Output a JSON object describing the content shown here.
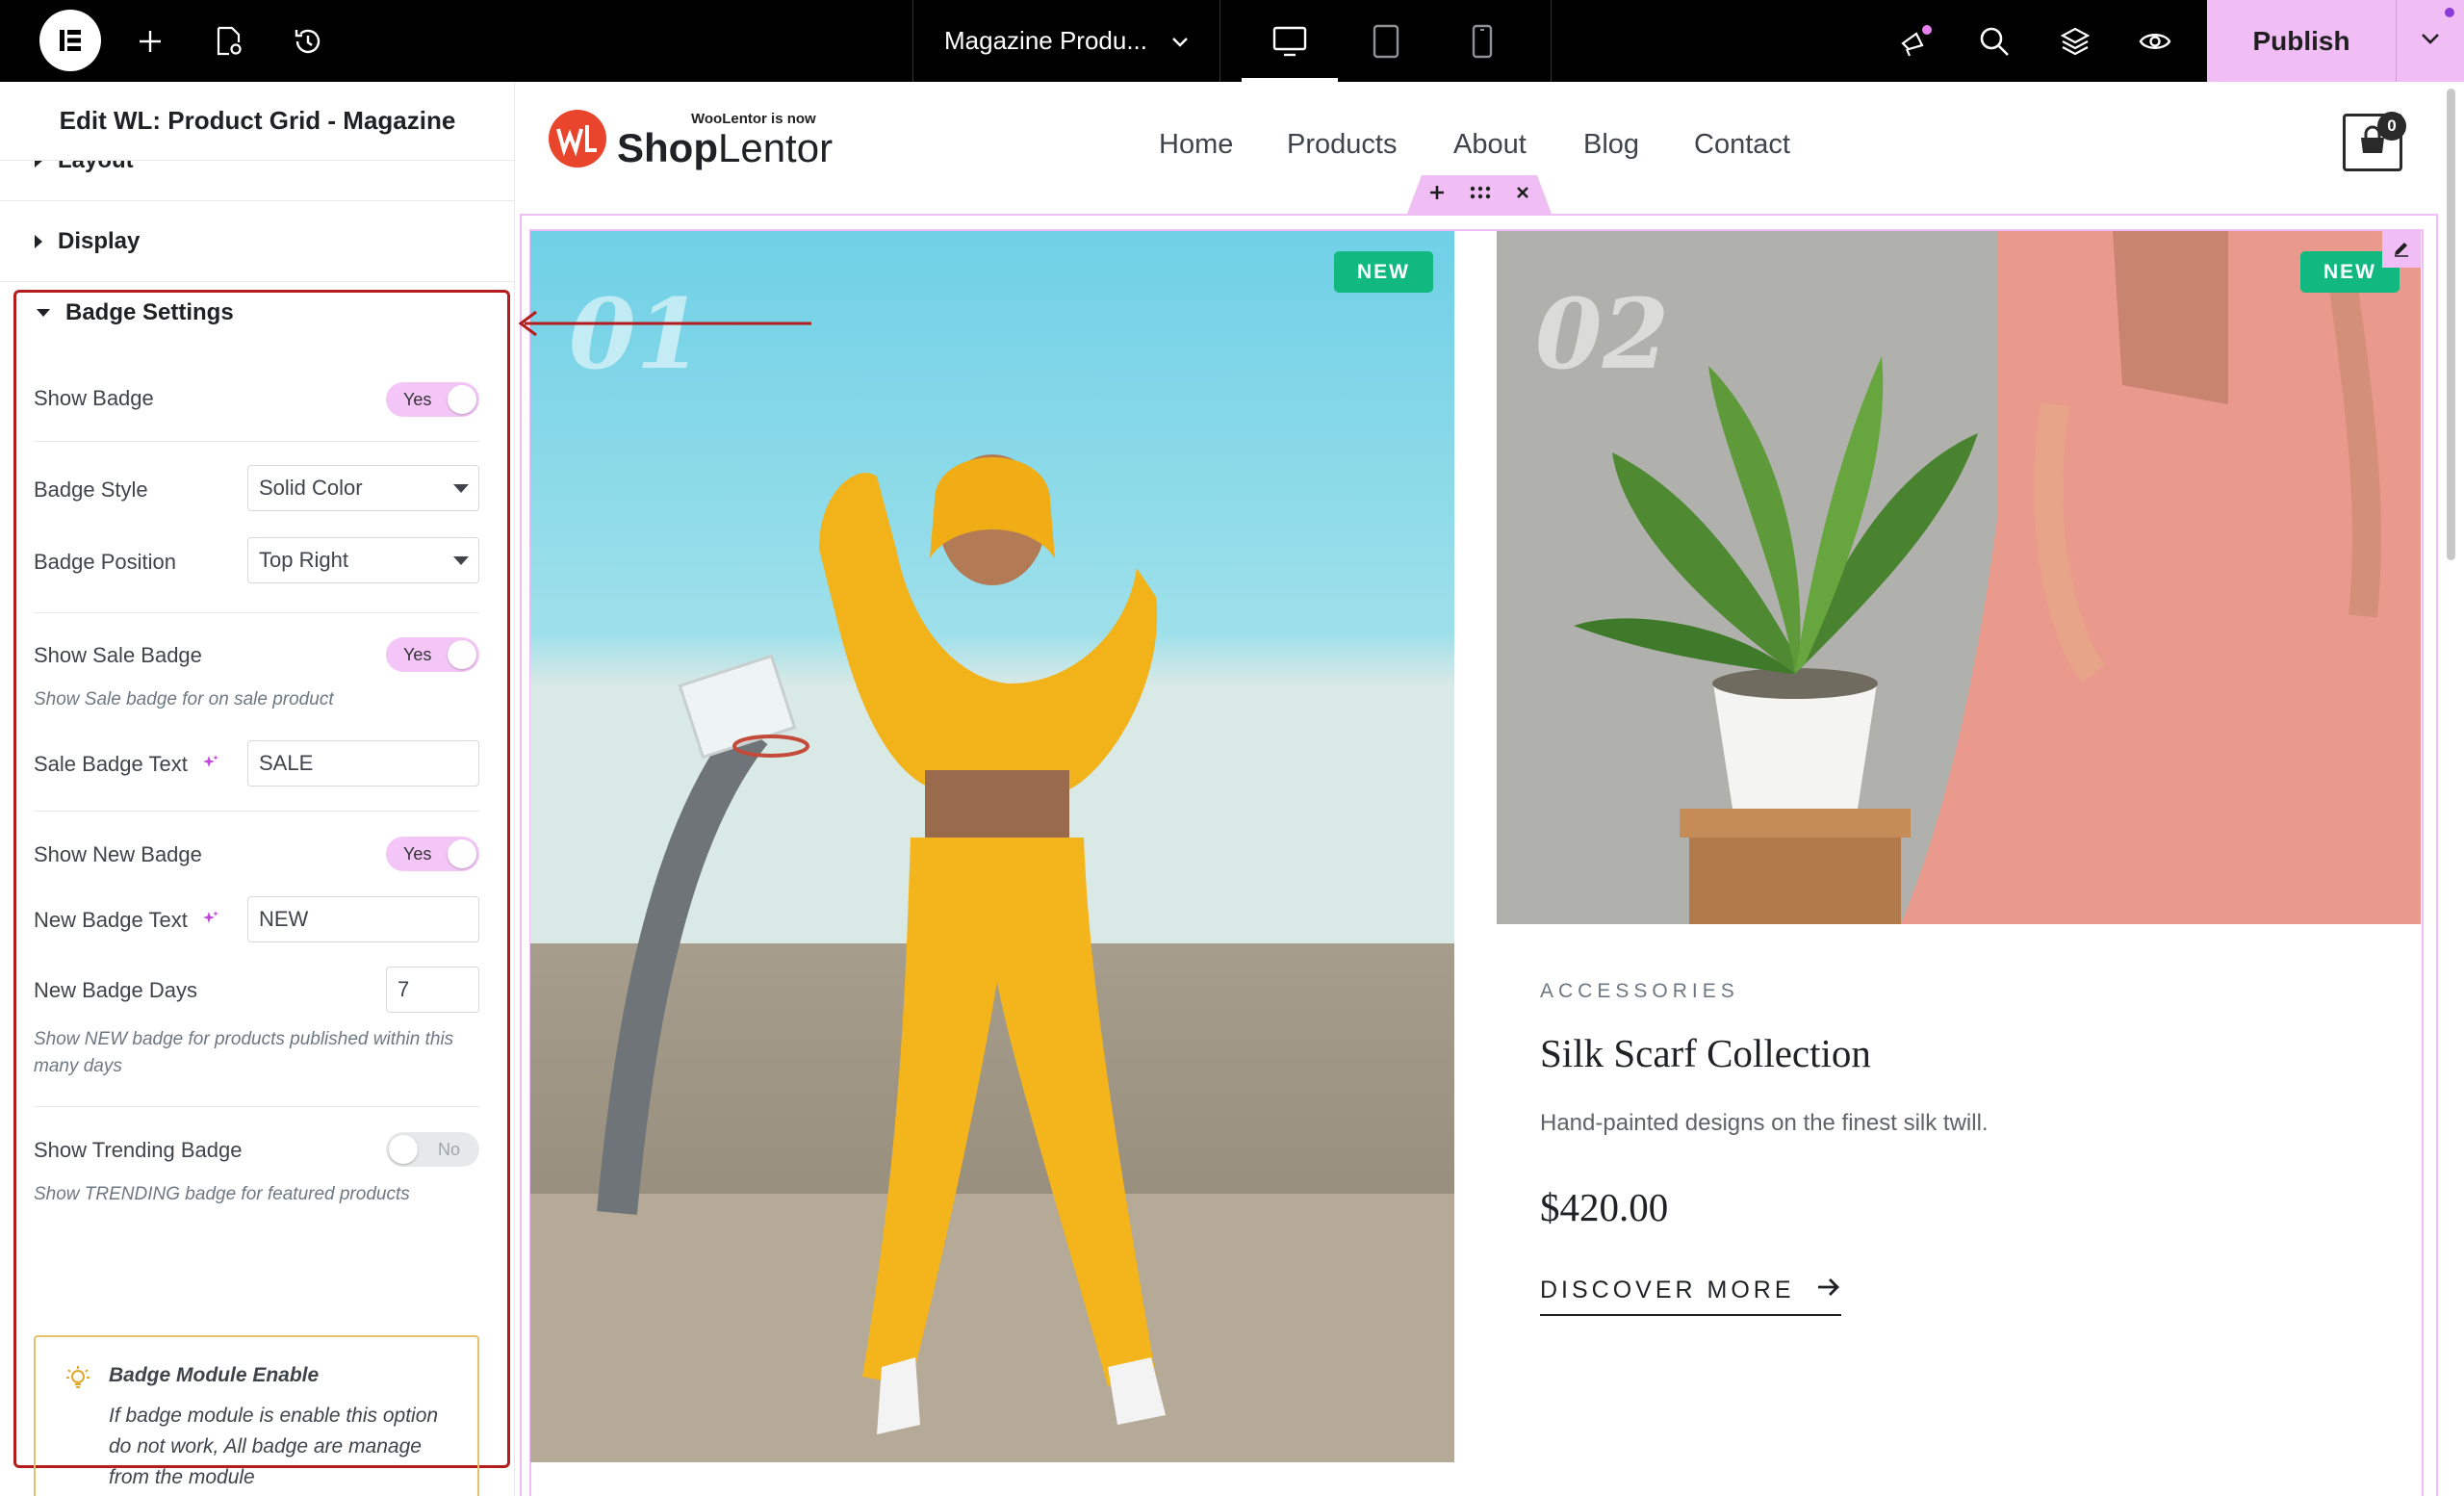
{
  "topbar": {
    "document_title": "Magazine Produ...",
    "publish_label": "Publish",
    "icons": [
      "elementor-logo-icon",
      "plus-icon",
      "page-settings-icon",
      "history-icon",
      "desktop-icon",
      "tablet-icon",
      "mobile-icon",
      "whats-new-icon",
      "search-icon",
      "layers-icon",
      "preview-eye-icon",
      "chevron-down-icon"
    ]
  },
  "panel": {
    "title": "Edit WL: Product Grid - Magazine",
    "sections": {
      "layout": "Layout",
      "display": "Display",
      "badge_settings": "Badge Settings"
    },
    "controls": {
      "show_badge": {
        "label": "Show Badge",
        "value": "Yes"
      },
      "badge_style": {
        "label": "Badge Style",
        "value": "Solid Color"
      },
      "badge_position": {
        "label": "Badge Position",
        "value": "Top Right"
      },
      "show_sale_badge": {
        "label": "Show Sale Badge",
        "value": "Yes",
        "note": "Show Sale badge for on sale product"
      },
      "sale_badge_text": {
        "label": "Sale Badge Text",
        "value": "SALE"
      },
      "show_new_badge": {
        "label": "Show New Badge",
        "value": "Yes"
      },
      "new_badge_text": {
        "label": "New Badge Text",
        "value": "NEW"
      },
      "new_badge_days": {
        "label": "New Badge Days",
        "value": "7",
        "note": "Show NEW badge for products published within this many days"
      },
      "show_trending_badge": {
        "label": "Show Trending Badge",
        "value": "No",
        "note": "Show TRENDING badge for featured products"
      }
    },
    "notice": {
      "title": "Badge Module Enable",
      "body": "If badge module is enable this option do not work, All badge are manage from the module"
    }
  },
  "site": {
    "logo_tagline": "WooLentor is now",
    "logo_bold": "Shop",
    "logo_light": "Lentor",
    "nav": [
      "Home",
      "Products",
      "About",
      "Blog",
      "Contact"
    ],
    "cart_count": "0"
  },
  "products": [
    {
      "number": "01",
      "badge": "NEW"
    },
    {
      "number": "02",
      "badge": "NEW",
      "category": "ACCESSORIES",
      "title": "Silk Scarf Collection",
      "description": "Hand-painted designs on the finest silk twill.",
      "price": "$420.00",
      "link": "DISCOVER MORE"
    }
  ],
  "colors": {
    "accent_pink": "#f0bdf5",
    "badge_green": "#11b981",
    "highlight_red": "#b41d1d",
    "brand_orange": "#e8452c"
  }
}
